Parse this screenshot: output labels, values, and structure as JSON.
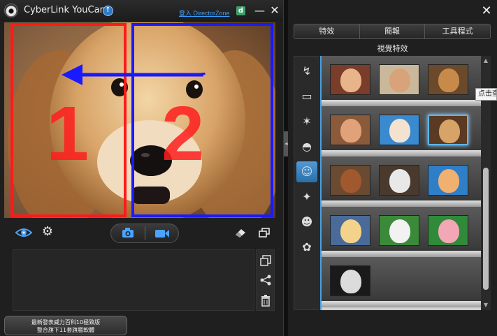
{
  "titlebar": {
    "app_title": "CyberLink YouCam",
    "directorzone_link": "登入 DirectorZone",
    "directorzone_icon_letter": "d",
    "minimize_glyph": "—",
    "close_glyph": "✕"
  },
  "viewport": {
    "region_1_label": "1",
    "region_2_label": "2",
    "region_1_color": "#ff1a1a",
    "region_2_color": "#1a1aff",
    "arrow_color": "#1a1aff"
  },
  "toolbar": {
    "icons": [
      "eye-icon",
      "gear-icon",
      "camera-icon",
      "video-icon",
      "eraser-icon",
      "window-icon"
    ]
  },
  "gallery_side": {
    "icons": [
      "import-icon",
      "share-icon",
      "trash-icon"
    ]
  },
  "promo": {
    "line1": "最新發表威力百科10極致版",
    "line2": "整合旗下11套旗艦軟體"
  },
  "right_panel": {
    "close_glyph": "✕",
    "tabs": [
      {
        "label": "特效"
      },
      {
        "label": "簡報"
      },
      {
        "label": "工具程式"
      }
    ],
    "section_title": "視覺特效",
    "tooltip": "点击查看"
  },
  "categories": {
    "icons": [
      "lightning-icon",
      "frame-icon",
      "magic-wand-icon",
      "mask-icon",
      "avatar-icon",
      "figure-icon",
      "smiley-icon",
      "star-flower-icon"
    ],
    "active_index": 4
  },
  "effects": {
    "rows": [
      [
        "girl-avatar",
        "boy-avatar",
        "bear-avatar"
      ],
      [
        "bald-man-avatar",
        "clown-avatar",
        "dog-avatar"
      ],
      [
        "poodle-avatar",
        "statue-avatar",
        "lion-avatar"
      ],
      [
        "blonde-avatar",
        "sheep-avatar",
        "pig-avatar"
      ],
      [
        "bust-avatar"
      ]
    ],
    "selected": "dog-avatar",
    "accent": "#5bb6ff"
  }
}
